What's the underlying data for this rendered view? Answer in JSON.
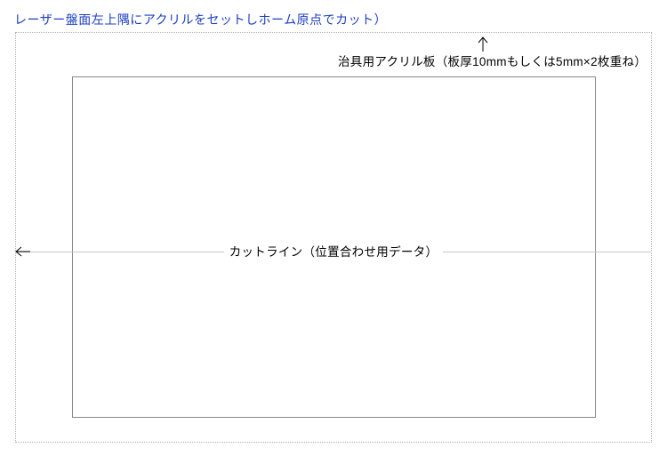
{
  "title": "レーザー盤面左上隅にアクリルをセットしホーム原点でカット）",
  "labels": {
    "acrylic_plate": "治具用アクリル板（板厚10mmもしくは5mm×2枚重ね）",
    "cut_line": "カットライン（位置合わせ用データ）"
  }
}
